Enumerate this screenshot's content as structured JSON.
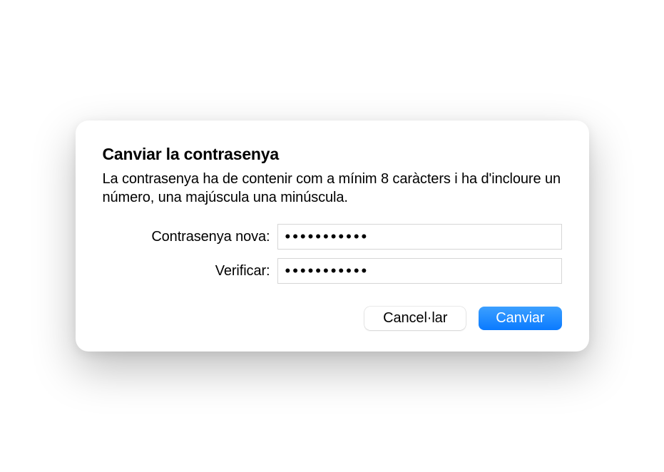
{
  "dialog": {
    "title": "Canviar la contrasenya",
    "description": "La contrasenya ha de contenir com a mínim 8 caràcters i ha d'incloure un número, una majúscula una minúscula.",
    "fields": {
      "new_password": {
        "label": "Contrasenya nova:",
        "value": "•••••••••••"
      },
      "verify": {
        "label": "Verificar:",
        "value": "•••••••••••"
      }
    },
    "buttons": {
      "cancel": "Cancel·lar",
      "confirm": "Canviar"
    }
  }
}
